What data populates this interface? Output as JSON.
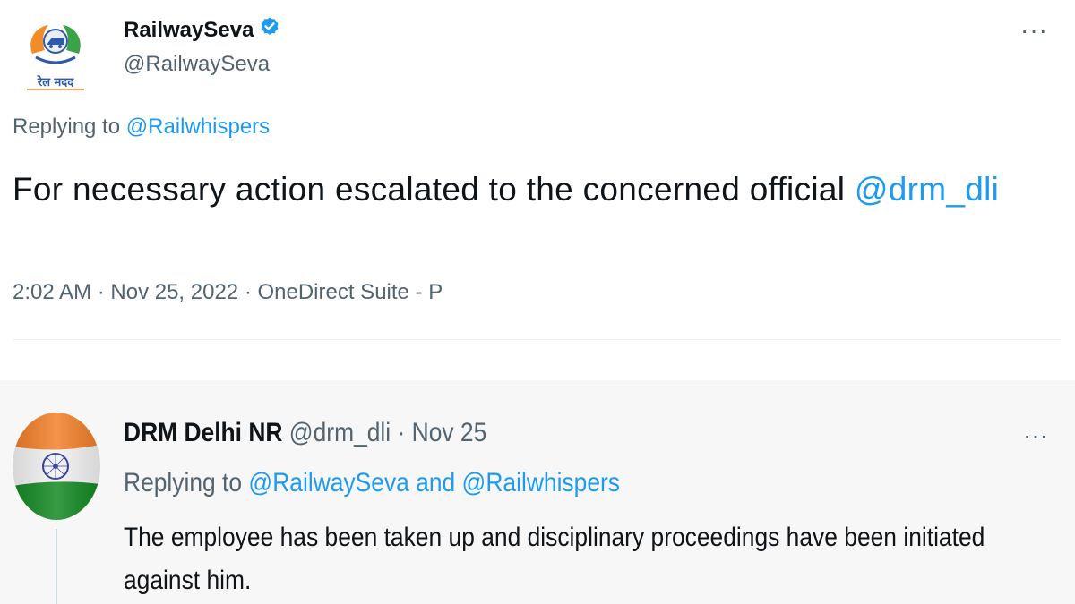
{
  "tweet_main": {
    "author_name": "RailwaySeva",
    "author_handle": "@RailwaySeva",
    "verified_icon": "verified-badge-icon",
    "avatar_logo_text": "रेल मदद",
    "more_icon": "more-options-icon",
    "more_label": "···",
    "replying_to_prefix": "Replying to ",
    "replying_to_handle": "@Railwhispers",
    "text": "For necessary action escalated to the concerned official ",
    "text_mention": "@drm_dli",
    "meta": "2:02 AM · Nov 25, 2022 · OneDirect Suite - P"
  },
  "tweet_reply": {
    "author_name": "DRM Delhi NR",
    "author_handle_time": " @drm_dli · Nov 25",
    "avatar_icon": "indian-flag-avatar-icon",
    "more_icon": "more-options-icon",
    "more_label": "···",
    "replying_to_prefix": "Replying to ",
    "replying_to_handles": "@RailwaySeva and @Railwhispers",
    "text": "The employee has been taken up and disciplinary proceedings have been initiated against him."
  },
  "colors": {
    "link": "#1d9bf0",
    "secondary_text": "#536471",
    "primary_text": "#0f1419",
    "reply_background": "#f7f7f7",
    "flag_saffron": "#f2802a",
    "flag_green": "#148a24",
    "chakra_navy": "#1f2e8f"
  }
}
